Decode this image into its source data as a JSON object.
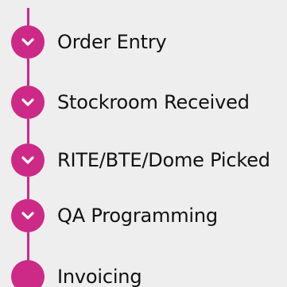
{
  "tracker": {
    "accent_color": "#cc2a86",
    "steps": [
      {
        "label": "Order Entry",
        "status": "complete",
        "icon": "chevron-down-icon"
      },
      {
        "label": "Stockroom Received",
        "status": "complete",
        "icon": "chevron-down-icon"
      },
      {
        "label": "RITE/BTE/Dome Picked",
        "status": "complete",
        "icon": "chevron-down-icon"
      },
      {
        "label": "QA Programming",
        "status": "complete",
        "icon": "chevron-down-icon"
      },
      {
        "label": "Invoicing",
        "status": "current",
        "icon": ""
      }
    ]
  }
}
